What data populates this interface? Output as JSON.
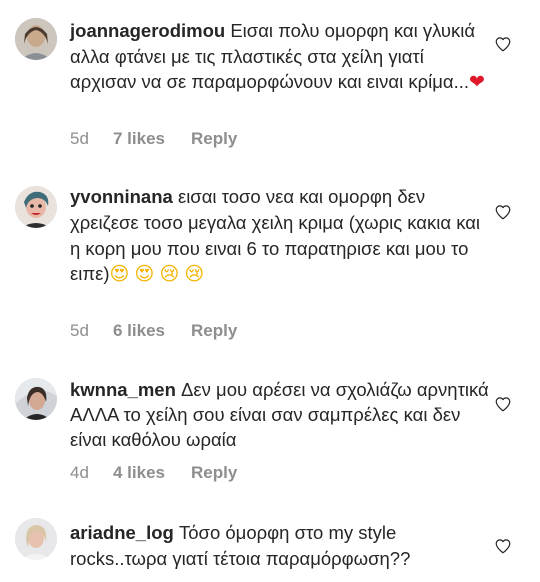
{
  "comments": [
    {
      "username": "joannagerodimou",
      "text": "Εισαι πολυ ομορφη και γλυκιά αλλα φτάνει με τις πλαστικές στα χείλη γιατί αρχισαν να σε παραμορφώνουν και ειναι κρίμα...",
      "emojis": [
        "❤"
      ],
      "age": "5d",
      "likes": "7 likes",
      "reply": "Reply",
      "avatar_icon": "avatar-photo"
    },
    {
      "username": "yvonninana",
      "text": "εισαι τοσο νεα και ομορφη δεν χρειζεσε τοσο μεγαλα χειλη κριμα (χωρις κακια και η κορη μου που ειναι 6 το παρατηρισε και μου το ειπε)",
      "emojis": [
        "😍",
        "😍",
        "😢",
        "😢"
      ],
      "age": "5d",
      "likes": "6 likes",
      "reply": "Reply",
      "avatar_icon": "avatar-photo"
    },
    {
      "username": "kwnna_men",
      "text": "Δεν μου αρέσει να σχολιάζω αρνητικά ΑΛΛΑ το χείλη σου είναι σαν σαμπρέλες και δεν είναι καθόλου ωραία",
      "emojis": [],
      "age": "4d",
      "likes": "4 likes",
      "reply": "Reply",
      "avatar_icon": "avatar-photo"
    },
    {
      "username": "ariadne_log",
      "text": "Τόσο όμορφη στο my style rocks..τωρα γιατί τέτοια παραμόρφωση??",
      "emojis": [],
      "avatar_icon": "avatar-photo"
    }
  ],
  "icons": {
    "like": "heart-outline-icon"
  },
  "colors": {
    "text": "#262626",
    "secondary": "#8e8e8e",
    "heart_emoji": "#e0182a"
  }
}
